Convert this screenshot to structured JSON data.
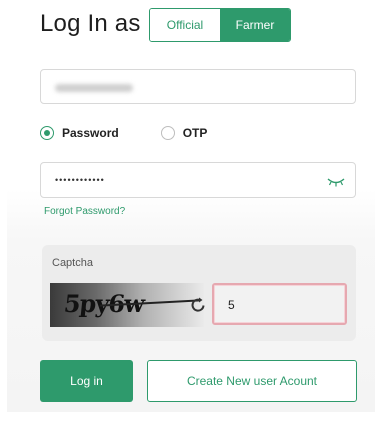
{
  "header": {
    "title": "Log In as"
  },
  "user_type": {
    "options": [
      "Official",
      "Farmer"
    ],
    "selected": "Farmer"
  },
  "username": {
    "value": ""
  },
  "auth_method": {
    "options": [
      "Password",
      "OTP"
    ],
    "selected": "Password"
  },
  "password": {
    "masked_value": "••••••••••••"
  },
  "links": {
    "forgot_password": "Forgot Password?"
  },
  "captcha": {
    "title": "Captcha",
    "image_text": "5py6w",
    "input_value": "5"
  },
  "buttons": {
    "login": "Log in",
    "create_account": "Create New user Acount"
  },
  "colors": {
    "accent": "#2e9a6c",
    "captcha_input_border": "#e6a8b0"
  },
  "icons": {
    "password_toggle": "eye-closed-icon",
    "captcha_refresh": "refresh-icon"
  }
}
